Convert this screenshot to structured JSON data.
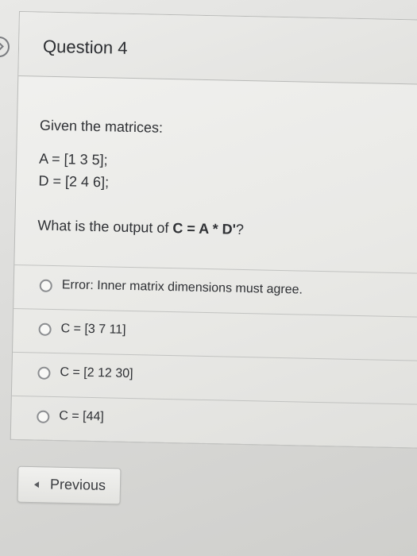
{
  "question": {
    "title": "Question 4",
    "intro": "Given the matrices:",
    "matrix_a": "A = [1 3 5];",
    "matrix_d": "D = [2 4 6];",
    "prompt_prefix": "What is the output of ",
    "prompt_expression": "C = A * D'",
    "prompt_suffix": "?"
  },
  "options": [
    {
      "label": "Error: Inner matrix dimensions must agree."
    },
    {
      "label": "C = [3 7 11]"
    },
    {
      "label": "C = [2 12 30]"
    },
    {
      "label": "C = [44]"
    }
  ],
  "navigation": {
    "previous_label": "Previous"
  }
}
